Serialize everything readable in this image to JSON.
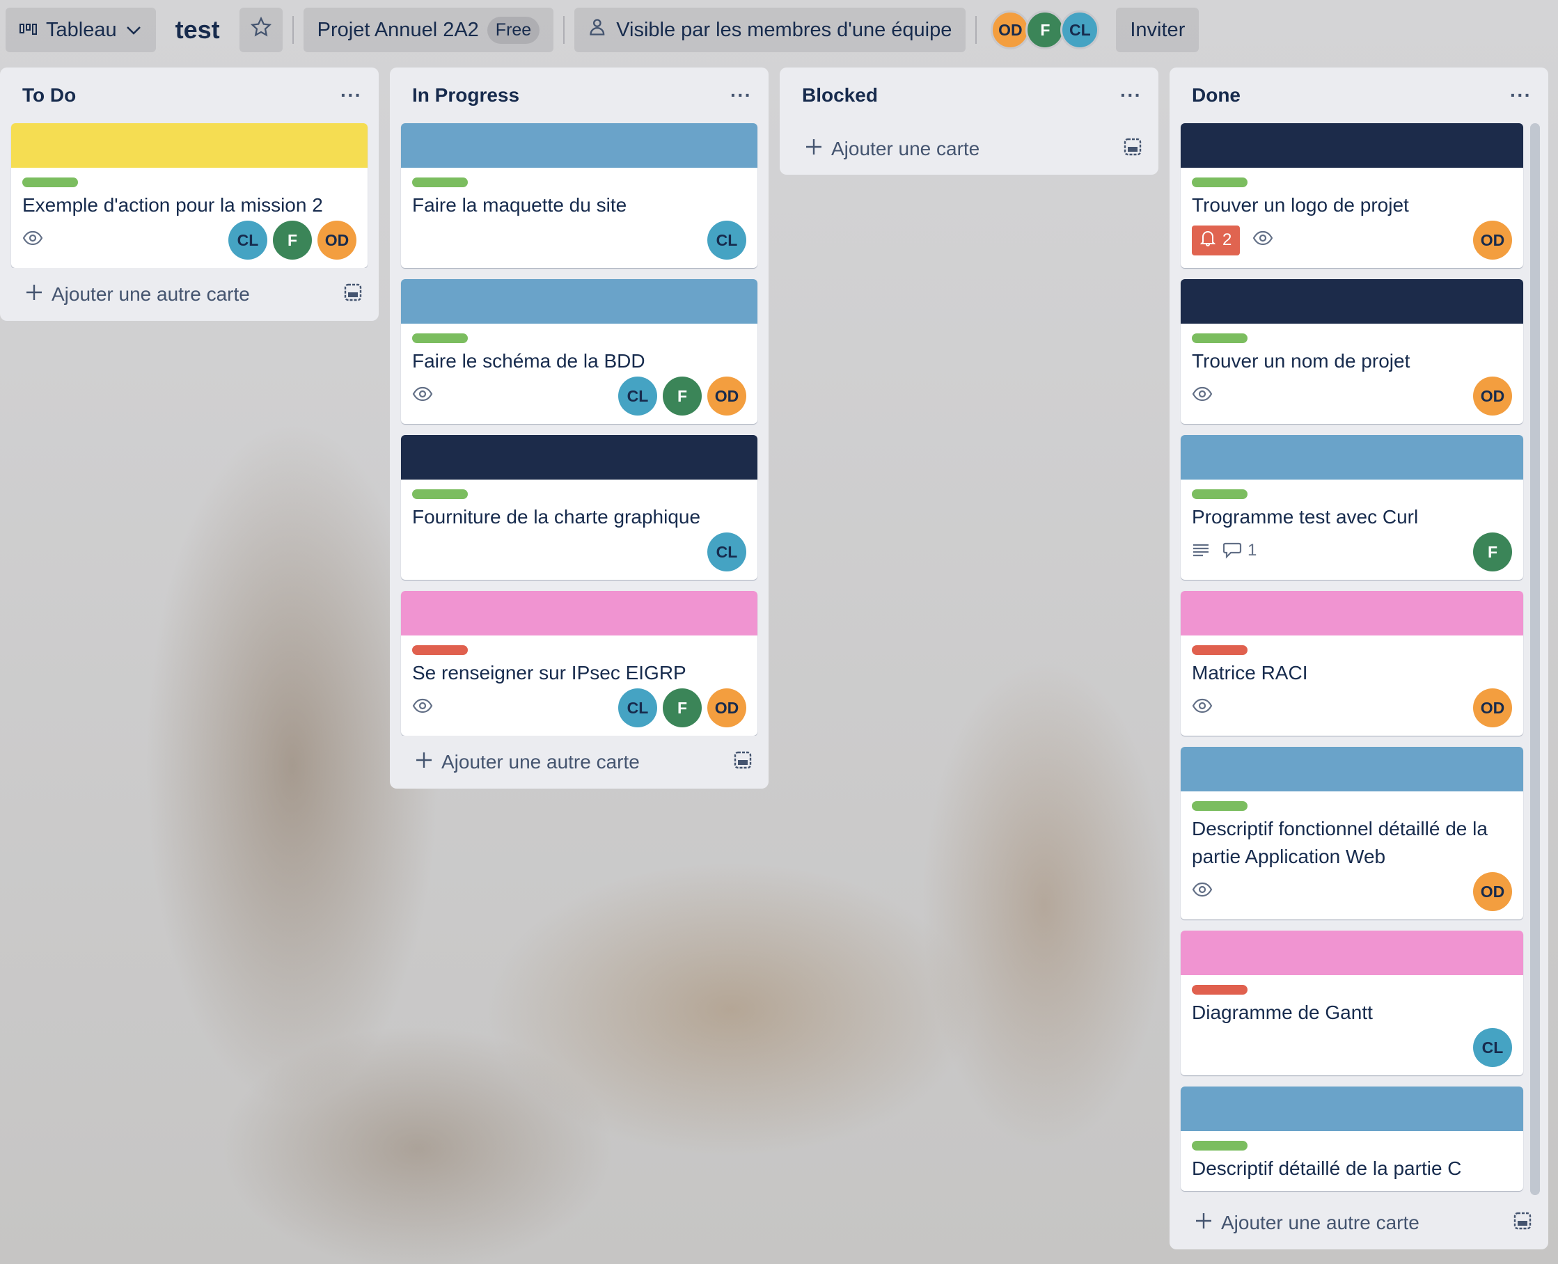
{
  "topbar": {
    "view_label": "Tableau",
    "board_title": "test",
    "workspace": "Projet Annuel 2A2",
    "plan_badge": "Free",
    "visibility": "Visible par les membres d'une équipe",
    "members": [
      "OD",
      "F",
      "CL"
    ],
    "invite_label": "Inviter"
  },
  "colors": {
    "yellow": "#f5dd52",
    "blue": "#6aa3c9",
    "navy": "#1c2b4a",
    "pink": "#f094d1",
    "green": "#7bbd5f",
    "red": "#e0604e",
    "CL": "#45a3c3",
    "F": "#3b8558",
    "OD": "#f39e3f"
  },
  "lists": [
    {
      "title": "To Do",
      "add_label": "Ajouter une autre carte",
      "cards": [
        {
          "cover": "yellow",
          "label": "green",
          "title": "Exemple d'action pour la mission 2",
          "watch": true,
          "members": [
            "CL",
            "F",
            "OD"
          ]
        }
      ]
    },
    {
      "title": "In Progress",
      "add_label": "Ajouter une autre carte",
      "cards": [
        {
          "cover": "blue",
          "label": "green",
          "title": "Faire la maquette du site",
          "members": [
            "CL"
          ]
        },
        {
          "cover": "blue",
          "label": "green",
          "title": "Faire le schéma de la BDD",
          "watch": true,
          "members": [
            "CL",
            "F",
            "OD"
          ]
        },
        {
          "cover": "navy",
          "label": "green",
          "title": "Fourniture de la charte graphique",
          "members": [
            "CL"
          ]
        },
        {
          "cover": "pink",
          "label": "red",
          "title": "Se renseigner sur IPsec EIGRP",
          "watch": true,
          "members": [
            "CL",
            "F",
            "OD"
          ]
        }
      ]
    },
    {
      "title": "Blocked",
      "add_label": "Ajouter une carte",
      "cards": []
    },
    {
      "title": "Done",
      "add_label": "Ajouter une autre carte",
      "cards": [
        {
          "cover": "navy",
          "label": "green",
          "title": "Trouver un logo de projet",
          "notifications": "2",
          "watch": true,
          "members": [
            "OD"
          ]
        },
        {
          "cover": "navy",
          "label": "green",
          "title": "Trouver un nom de projet",
          "watch": true,
          "members": [
            "OD"
          ]
        },
        {
          "cover": "blue",
          "label": "green",
          "title": "Programme test avec Curl",
          "description": true,
          "comments": "1",
          "members": [
            "F"
          ]
        },
        {
          "cover": "pink",
          "label": "red",
          "title": "Matrice RACI",
          "watch": true,
          "members": [
            "OD"
          ]
        },
        {
          "cover": "blue",
          "label": "green",
          "title": "Descriptif fonctionnel détaillé de la partie Application Web",
          "watch": true,
          "members": [
            "OD"
          ]
        },
        {
          "cover": "pink",
          "label": "red",
          "title": "Diagramme de Gantt",
          "members": [
            "CL"
          ]
        },
        {
          "cover": "blue",
          "label": "green",
          "title": "Descriptif détaillé de la partie C"
        }
      ]
    }
  ]
}
